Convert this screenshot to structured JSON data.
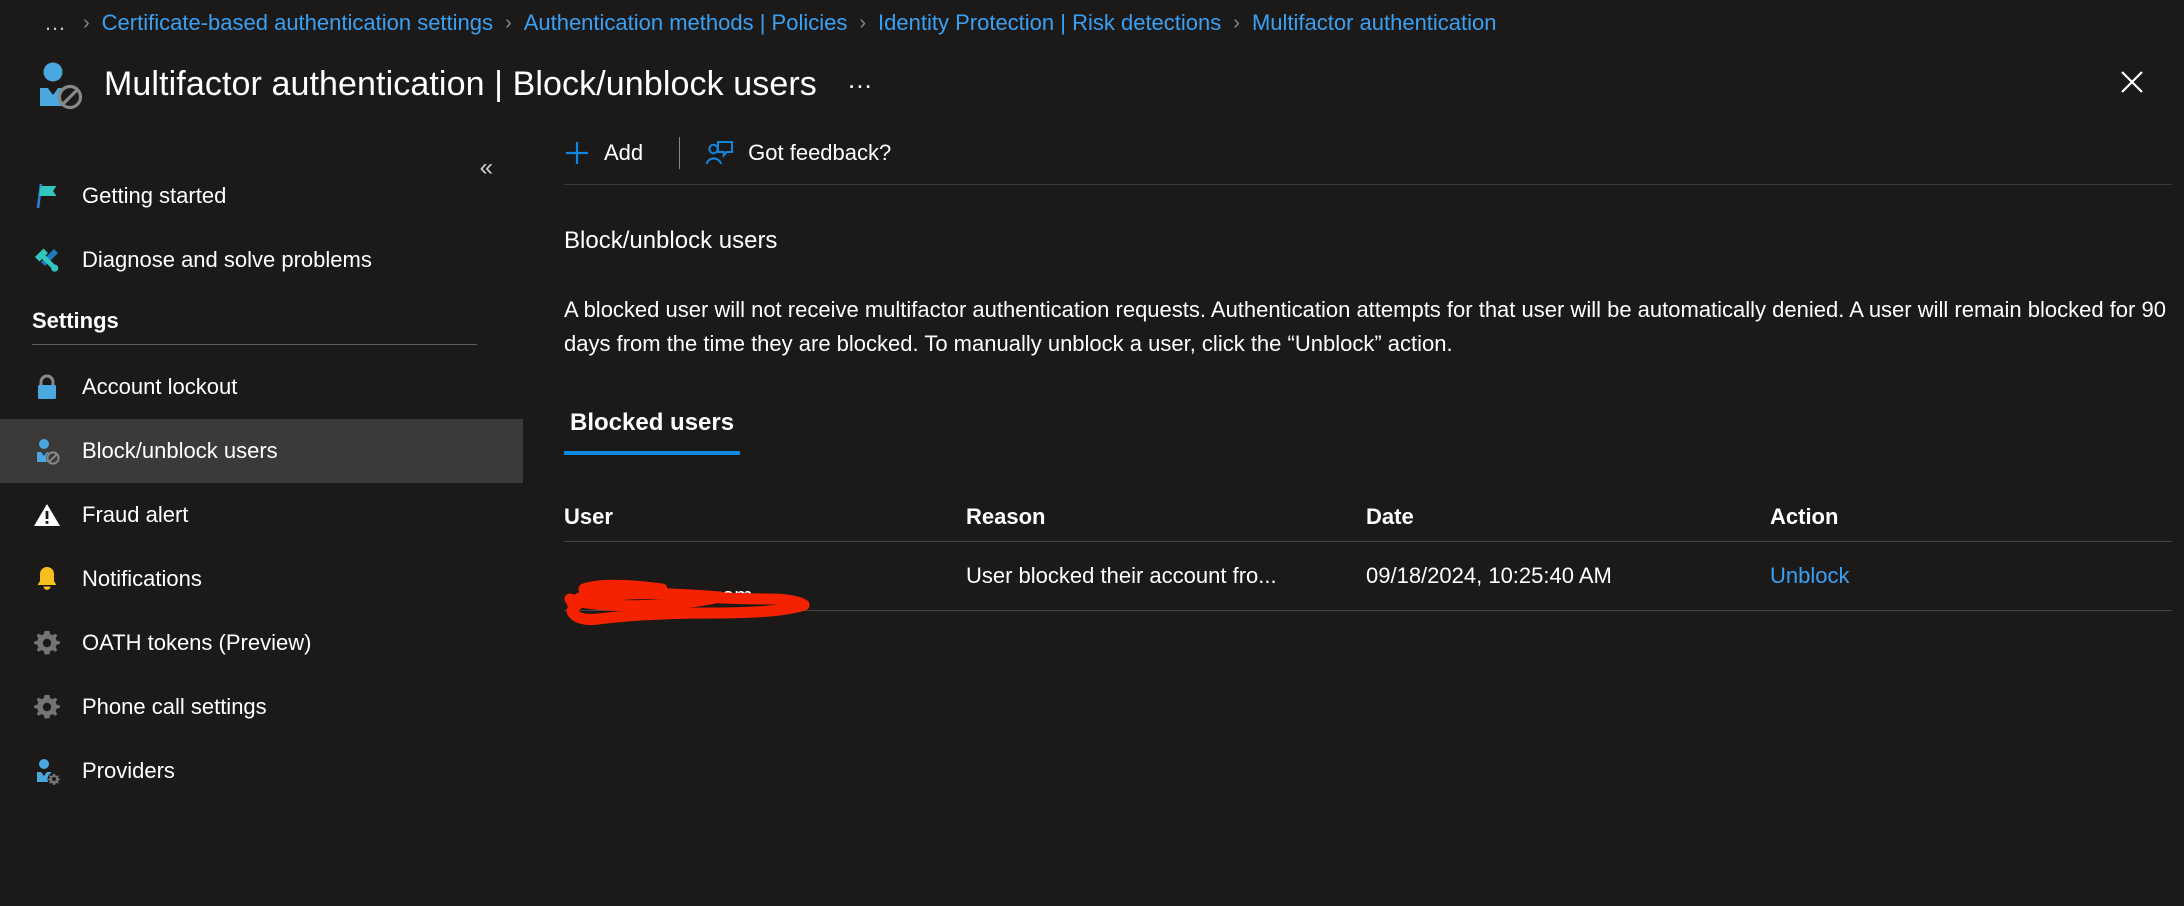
{
  "breadcrumb": {
    "overflow_label": "…",
    "separator": "›",
    "items": [
      {
        "label": "Certificate-based authentication settings"
      },
      {
        "label": "Authentication methods | Policies"
      },
      {
        "label": "Identity Protection | Risk detections"
      },
      {
        "label": "Multifactor authentication"
      }
    ]
  },
  "header": {
    "icon": "user-blocked-icon",
    "title": "Multifactor authentication | Block/unblock users",
    "more_label": "…",
    "close_icon": "close-icon"
  },
  "sidebar": {
    "collapse_icon": "chevron-double-left-icon",
    "top_items": [
      {
        "label": "Getting started",
        "icon": "flag-icon",
        "selected": false
      },
      {
        "label": "Diagnose and solve problems",
        "icon": "wrench-screwdriver-icon",
        "selected": false
      }
    ],
    "section_label": "Settings",
    "items": [
      {
        "label": "Account lockout",
        "icon": "lock-icon",
        "selected": false
      },
      {
        "label": "Block/unblock users",
        "icon": "user-blocked-icon",
        "selected": true
      },
      {
        "label": "Fraud alert",
        "icon": "warning-triangle-icon",
        "selected": false
      },
      {
        "label": "Notifications",
        "icon": "bell-icon",
        "selected": false
      },
      {
        "label": "OATH tokens (Preview)",
        "icon": "gear-icon",
        "selected": false
      },
      {
        "label": "Phone call settings",
        "icon": "gear-icon",
        "selected": false
      },
      {
        "label": "Providers",
        "icon": "user-gear-icon",
        "selected": false
      }
    ]
  },
  "toolbar": {
    "add_label": "Add",
    "add_icon": "plus-icon",
    "feedback_label": "Got feedback?",
    "feedback_icon": "feedback-person-icon"
  },
  "main": {
    "section_title": "Block/unblock users",
    "description": "A blocked user will not receive multifactor authentication requests. Authentication attempts for that user will be automatically denied. A user will remain blocked for 90 days from the time they are blocked. To manually unblock a user, click the “Unblock” action.",
    "tabs": [
      {
        "label": "Blocked users",
        "active": true
      }
    ],
    "table": {
      "columns": [
        "User",
        "Reason",
        "Date",
        "Action"
      ],
      "rows": [
        {
          "user": "om",
          "user_redacted": true,
          "reason": "User blocked their account fro...",
          "date": "09/18/2024, 10:25:40 AM",
          "action": "Unblock"
        }
      ]
    }
  },
  "colors": {
    "page_background": "#1b1a19",
    "link_blue": "#3aa0f3",
    "accent_blue": "#0f86e0",
    "selected_item": "#3b3a39",
    "icon_blue": "#4aa7e0",
    "icon_teal": "#30c8bd",
    "icon_yellow": "#f5bf1d",
    "icon_gray": "#767472",
    "redaction_red": "#f52200"
  }
}
